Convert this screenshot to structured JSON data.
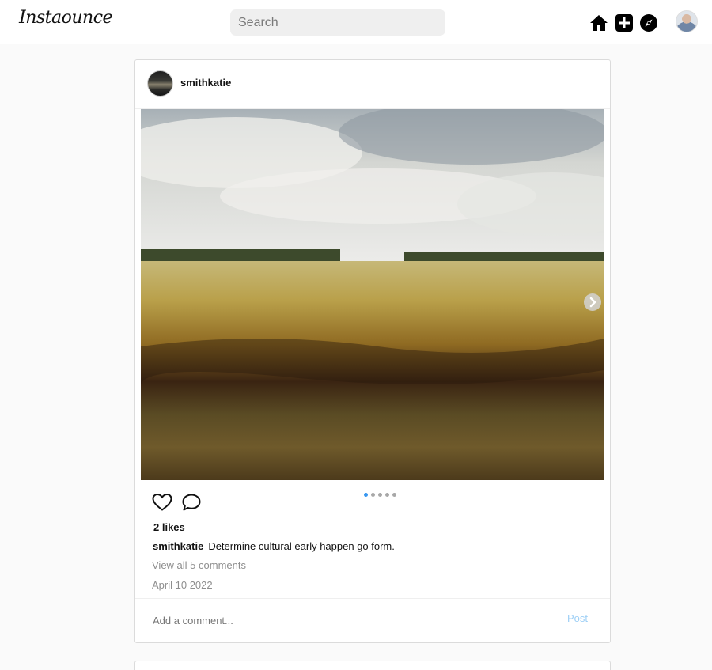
{
  "app": {
    "logo_text": "Instaounce"
  },
  "search": {
    "placeholder": "Search"
  },
  "nav": {
    "icons": [
      "home-icon",
      "new-post-icon",
      "explore-icon"
    ],
    "profile_avatar": "profile-avatar"
  },
  "post": {
    "username": "smithkatie",
    "likes_text": "2 likes",
    "caption_user": "smithkatie",
    "caption_text": "Determine cultural early happen go form.",
    "view_comments": "View all 5 comments",
    "date": "April 10 2022",
    "comment_placeholder": "Add a comment...",
    "post_button": "Post",
    "carousel": {
      "slide_count": 5,
      "active_index": 0
    },
    "actions": [
      "heart-icon",
      "comment-icon"
    ]
  },
  "colors": {
    "accent": "#3897f0",
    "post_button": "#9fd0f6",
    "muted_text": "#8e8e8e",
    "background": "#fafafa"
  }
}
